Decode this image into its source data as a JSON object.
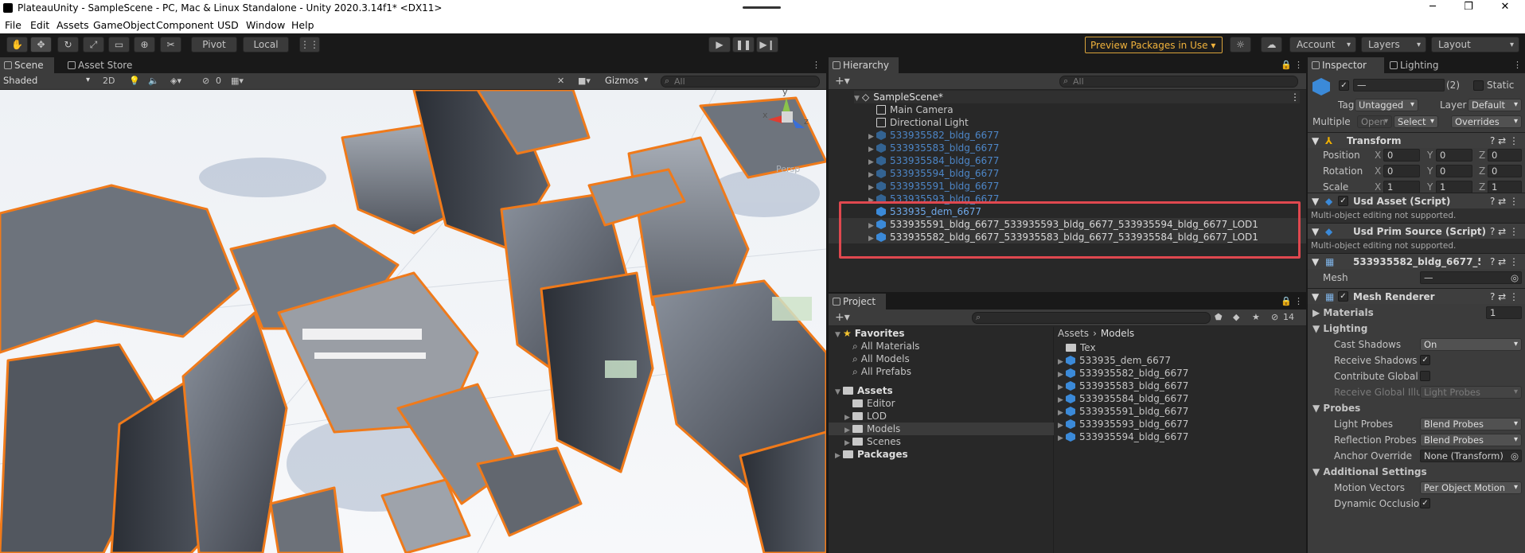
{
  "window": {
    "title": "PlateauUnity - SampleScene - PC, Mac & Linux Standalone - Unity 2020.3.14f1* <DX11>"
  },
  "menu": [
    "File",
    "Edit",
    "Assets",
    "GameObject",
    "Component",
    "USD",
    "Window",
    "Help"
  ],
  "toolbar": {
    "pivot": "Pivot",
    "local": "Local",
    "preview_packages": "Preview Packages in Use",
    "account": "Account",
    "layers": "Layers",
    "layout": "Layout"
  },
  "scene": {
    "tab_scene": "Scene",
    "tab_asset_store": "Asset Store",
    "shading": "Shaded",
    "mode_2d": "2D",
    "hidden_count": "0",
    "gizmos": "Gizmos",
    "search_placeholder": "All",
    "persp": "Persp",
    "axes": {
      "x": "x",
      "y": "y",
      "z": "z"
    }
  },
  "hierarchy": {
    "tab": "Hierarchy",
    "search_placeholder": "All",
    "scene_name": "SampleScene*",
    "items": [
      {
        "label": "Main Camera",
        "style": "normal"
      },
      {
        "label": "Directional Light",
        "style": "normal"
      },
      {
        "label": "533935582_bldg_6677",
        "style": "dim"
      },
      {
        "label": "533935583_bldg_6677",
        "style": "dim"
      },
      {
        "label": "533935584_bldg_6677",
        "style": "dim"
      },
      {
        "label": "533935594_bldg_6677",
        "style": "dim"
      },
      {
        "label": "533935591_bldg_6677",
        "style": "dim"
      },
      {
        "label": "533935593_bldg_6677",
        "style": "dim"
      },
      {
        "label": "533935_dem_6677",
        "style": "prefab"
      },
      {
        "label": "533935591_bldg_6677_533935593_bldg_6677_533935594_bldg_6677_LOD1",
        "style": "selected"
      },
      {
        "label": "533935582_bldg_6677_533935583_bldg_6677_533935584_bldg_6677_LOD1",
        "style": "selected"
      }
    ]
  },
  "project": {
    "tab": "Project",
    "hidden_count": "14",
    "favorites_label": "Favorites",
    "favorites": [
      "All Materials",
      "All Models",
      "All Prefabs"
    ],
    "assets_label": "Assets",
    "asset_folders": [
      "Editor",
      "LOD",
      "Models",
      "Scenes"
    ],
    "packages_label": "Packages",
    "breadcrumb": [
      "Assets",
      "Models"
    ],
    "files": [
      "Tex",
      "533935_dem_6677",
      "533935582_bldg_6677",
      "533935583_bldg_6677",
      "533935584_bldg_6677",
      "533935591_bldg_6677",
      "533935593_bldg_6677",
      "533935594_bldg_6677"
    ]
  },
  "inspector": {
    "tab_inspector": "Inspector",
    "tab_lighting": "Lighting",
    "name_value": "—",
    "count": "(2)",
    "static_label": "Static",
    "tag_label": "Tag",
    "tag_value": "Untagged",
    "layer_label": "Layer",
    "layer_value": "Default",
    "multiple_label": "Multiple",
    "open_label": "Open",
    "select_label": "Select",
    "overrides_label": "Overrides",
    "transform": {
      "title": "Transform",
      "rows": [
        {
          "label": "Position",
          "x": "0",
          "y": "0",
          "z": "0"
        },
        {
          "label": "Rotation",
          "x": "0",
          "y": "0",
          "z": "0"
        },
        {
          "label": "Scale",
          "x": "1",
          "y": "1",
          "z": "1"
        }
      ]
    },
    "usd_asset": {
      "title": "Usd Asset (Script)",
      "note": "Multi-object editing not supported."
    },
    "usd_prim": {
      "title": "Usd Prim Source (Script)",
      "note": "Multi-object editing not supported."
    },
    "mesh_filter": {
      "title": "533935582_bldg_6677_5",
      "mesh_label": "Mesh",
      "mesh_value": "—"
    },
    "mesh_renderer": {
      "title": "Mesh Renderer",
      "materials_label": "Materials",
      "materials_count": "1",
      "lighting_label": "Lighting",
      "cast_shadows_label": "Cast Shadows",
      "cast_shadows_value": "On",
      "receive_shadows_label": "Receive Shadows",
      "contribute_gi_label": "Contribute Global I",
      "receive_gi_label": "Receive Global Illu",
      "receive_gi_value": "Light Probes",
      "probes_label": "Probes",
      "light_probes_label": "Light Probes",
      "light_probes_value": "Blend Probes",
      "reflection_probes_label": "Reflection Probes",
      "reflection_probes_value": "Blend Probes",
      "anchor_override_label": "Anchor Override",
      "anchor_override_value": "None (Transform)",
      "additional_label": "Additional Settings",
      "motion_vectors_label": "Motion Vectors",
      "motion_vectors_value": "Per Object Motion",
      "dynamic_occlusion_label": "Dynamic Occlusio"
    }
  },
  "colors": {
    "highlight_box": "#e0484f",
    "selection_outline": "#f07a1a",
    "accent_blue": "#3b8ad9"
  }
}
